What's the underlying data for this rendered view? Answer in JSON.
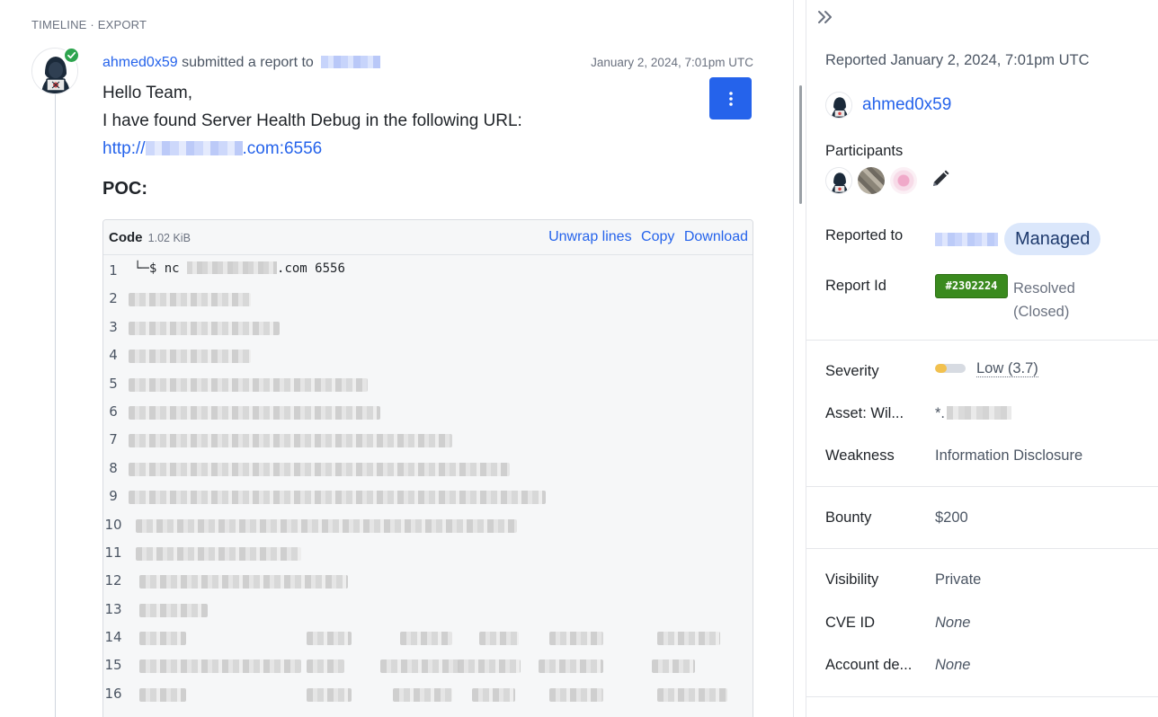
{
  "breadcrumb": "TIMELINE · EXPORT",
  "report": {
    "username": "ahmed0x59",
    "action_text": "submitted a report to",
    "date": "January 2, 2024, 7:01pm UTC",
    "greeting": "Hello Team,",
    "intro": "I have found Server Health Debug in the following URL:",
    "url_prefix": "http://",
    "url_suffix": ".com:6556",
    "poc_heading": "POC:"
  },
  "code": {
    "title": "Code",
    "size": "1.02 KiB",
    "actions": [
      "Unwrap lines",
      "Copy",
      "Download"
    ],
    "first_line_prefix": "└─$ nc ",
    "first_line_suffix": ".com 6556",
    "line_numbers": [
      "1",
      "2",
      "3",
      "4",
      "5",
      "6",
      "7",
      "8",
      "9",
      "10",
      "11",
      "12",
      "13",
      "14",
      "15",
      "16"
    ]
  },
  "sidebar": {
    "reported_on": "Reported January 2, 2024, 7:01pm UTC",
    "reporter": "ahmed0x59",
    "participants_label": "Participants",
    "reported_to_label": "Reported to",
    "managed_badge": "Managed",
    "report_id_label": "Report Id",
    "report_id": "#2302224",
    "status_line1": "Resolved",
    "status_line2": "(Closed)",
    "severity_label": "Severity",
    "severity_value": "Low (3.7)",
    "severity_score": 3.7,
    "asset_label": "Asset: Wil...",
    "asset_prefix": "*.",
    "weakness_label": "Weakness",
    "weakness_value": "Information Disclosure",
    "bounty_label": "Bounty",
    "bounty_value": "$200",
    "visibility_label": "Visibility",
    "visibility_value": "Private",
    "cve_label": "CVE ID",
    "cve_value": "None",
    "account_label": "Account de...",
    "account_value": "None"
  },
  "colors": {
    "link": "#2563eb",
    "primary_button": "#2563eb",
    "report_id_badge": "#3a8a1e",
    "managed_badge_bg": "#dbe7fb",
    "severity_low": "#f2c14e",
    "verified": "#2da44e"
  },
  "icons": {
    "verified": "check-badge-icon",
    "kebab": "vertical-dots-icon",
    "collapse": "double-chevron-right-icon",
    "edit": "pencil-icon"
  }
}
